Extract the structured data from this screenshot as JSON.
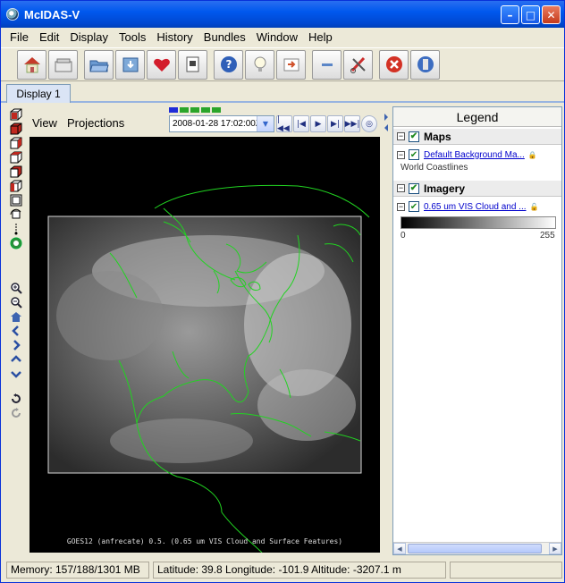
{
  "window": {
    "title": "McIDAS-V"
  },
  "titlebar_buttons": {
    "minimize": "–",
    "maximize": "□",
    "close": "✕"
  },
  "menubar": [
    "File",
    "Edit",
    "Display",
    "Tools",
    "History",
    "Bundles",
    "Window",
    "Help"
  ],
  "toolbar": {
    "icons": [
      "home-icon",
      "blank-display-icon",
      "open-folder-icon",
      "save-bundle-icon",
      "favorite-heart-icon",
      "data-source-icon",
      "help-icon",
      "tip-lightbulb-icon",
      "forward-icon",
      "minimize-icon",
      "cut-icon",
      "stop-icon",
      "exit-icon"
    ]
  },
  "tabs": [
    {
      "label": "Display 1",
      "selected": true
    }
  ],
  "view_menu": {
    "view": "View",
    "projections": "Projections"
  },
  "animation": {
    "date_time": "2008-01-28 17:02:00Z",
    "frame_indicators": [
      "#1e2bd8",
      "#2aa52a",
      "#2aa52a",
      "#2aa52a",
      "#2aa52a"
    ],
    "buttons": [
      "first",
      "previous",
      "play",
      "next",
      "last",
      "settings"
    ]
  },
  "map": {
    "caption": "GOES12 (anfrecate) 0.5. (0.65 um VIS Cloud and Surface Features)"
  },
  "legend": {
    "title": "Legend",
    "groups": [
      {
        "name": "Maps",
        "layers": [
          {
            "label": "Default Background Ma...",
            "subtitle": "World Coastlines"
          }
        ]
      },
      {
        "name": "Imagery",
        "layers": [
          {
            "label": "0.65 um VIS Cloud and ...",
            "range_min": "0",
            "range_max": "255"
          }
        ]
      }
    ]
  },
  "status": {
    "memory": "Memory: 157/188/1301 MB",
    "position": "Latitude:   39.8 Longitude: -101.9 Altitude: -3207.1 m"
  },
  "colors": {
    "titlebar": "#0058ee",
    "coastline": "#21d321",
    "link": "#0000cc"
  }
}
